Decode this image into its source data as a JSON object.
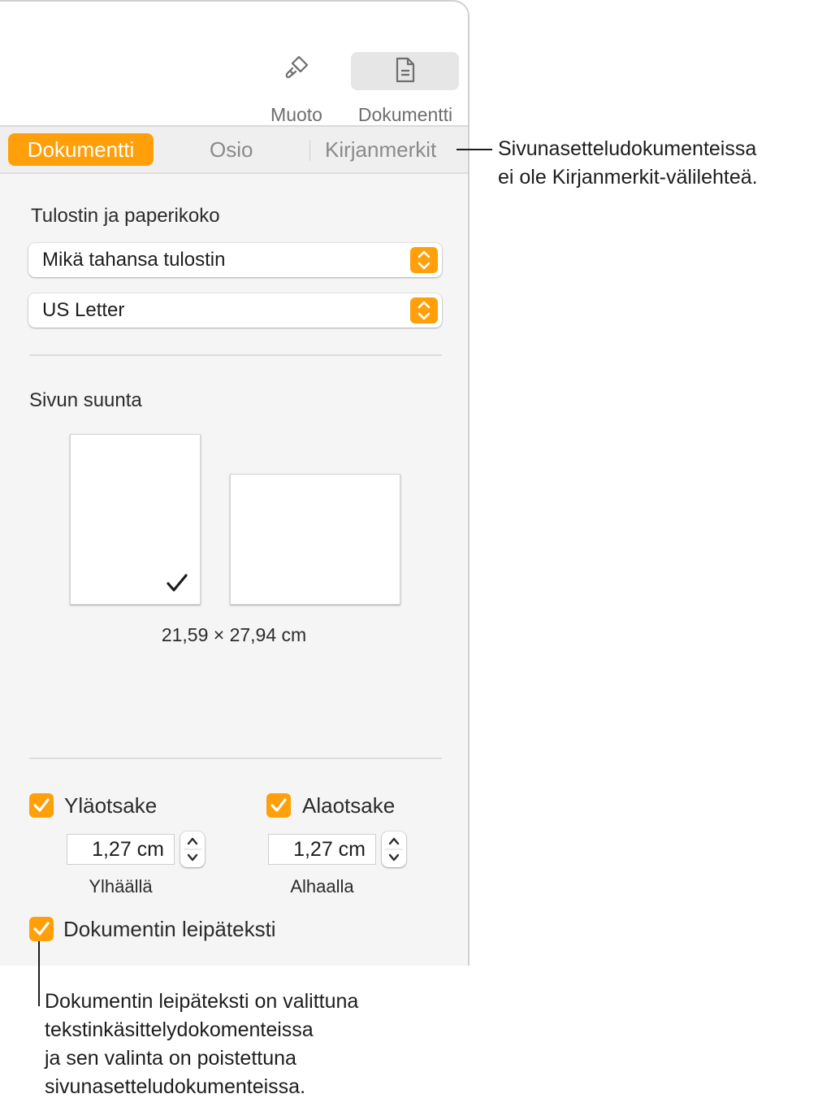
{
  "toolbar": {
    "format_label": "Muoto",
    "document_label": "Dokumentti"
  },
  "tabs": {
    "document": "Dokumentti",
    "section": "Osio",
    "bookmarks": "Kirjanmerkit"
  },
  "printer": {
    "section_title": "Tulostin ja paperikoko",
    "printer_value": "Mikä tahansa tulostin",
    "paper_value": "US Letter"
  },
  "orientation": {
    "section_title": "Sivun suunta",
    "selected": "portrait",
    "dimensions": "21,59 × 27,94 cm"
  },
  "header_footer": {
    "header_label": "Yläotsake",
    "header_checked": true,
    "header_value": "1,27 cm",
    "header_sub": "Ylhäällä",
    "footer_label": "Alaotsake",
    "footer_checked": true,
    "footer_value": "1,27 cm",
    "footer_sub": "Alhaalla",
    "body_label": "Dokumentin leipäteksti",
    "body_checked": true
  },
  "callouts": {
    "bookmarks_line1": "Sivunasetteludokumenteissa",
    "bookmarks_line2": "ei ole Kirjanmerkit-välilehteä.",
    "body_line1": "Dokumentin leipäteksti on valittuna",
    "body_line2": "tekstinkäsittelydokomenteissa",
    "body_line3": "ja sen valinta on poistettuna",
    "body_line4": "sivunasetteludokumenteissa."
  },
  "colors": {
    "accent": "#ff9f0a",
    "panel_bg": "#f5f5f5"
  }
}
